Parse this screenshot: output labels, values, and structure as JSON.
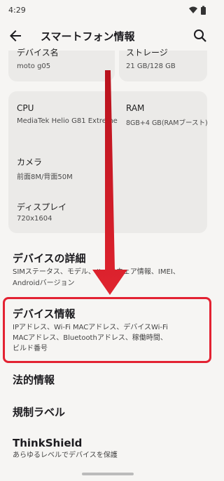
{
  "status": {
    "time": "4:29"
  },
  "appbar": {
    "title": "スマートフォン情報"
  },
  "device_name": {
    "label": "デバイス名",
    "value": "moto g05"
  },
  "storage": {
    "label": "ストレージ",
    "value": "21 GB/128 GB"
  },
  "cpu": {
    "label": "CPU",
    "value": "MediaTek Helio G81 Extreme"
  },
  "ram": {
    "label": "RAM",
    "value": "8GB+4 GB(RAMブースト)"
  },
  "camera": {
    "label": "カメラ",
    "value": "前面8M/背面50M"
  },
  "display": {
    "label": "ディスプレイ",
    "value": "720x1604"
  },
  "sections": {
    "device_details": {
      "title": "デバイスの詳細",
      "desc1": "SIMステータス、モデル、ハードウェア情報、IMEI、",
      "desc2": "Androidバージョン"
    },
    "device_info": {
      "title": "デバイス情報",
      "desc1": "IPアドレス、Wi-Fi MACアドレス、デバイスWi-Fi",
      "desc2": "MACアドレス、Bluetoothアドレス、稼働時間、",
      "desc3": "ビルド番号"
    },
    "legal": {
      "title": "法的情報"
    },
    "regulatory": {
      "title": "規制ラベル"
    },
    "thinkshield": {
      "title": "ThinkShield",
      "desc1": "あらゆるレベルでデバイスを保護"
    }
  },
  "colors": {
    "highlight": "#e32232",
    "arrow": "#d81e2a"
  }
}
